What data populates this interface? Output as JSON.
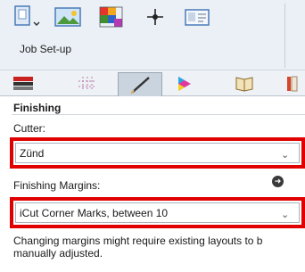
{
  "toolbar": {
    "buttons": [
      {
        "icon": "page-layout-icon",
        "has_dropdown": true
      },
      {
        "icon": "image-icon"
      },
      {
        "icon": "color-palette-icon"
      },
      {
        "icon": "crosshair-icon"
      },
      {
        "icon": "id-card-icon"
      }
    ],
    "section_label": "Job Set-up"
  },
  "tabs": [
    {
      "icon": "media-stack-icon",
      "active": false
    },
    {
      "icon": "grid-dots-icon",
      "active": false
    },
    {
      "icon": "cut-line-icon",
      "active": true
    },
    {
      "icon": "color-profile-icon",
      "active": false
    },
    {
      "icon": "book-icon",
      "active": false
    },
    {
      "icon": "partial-icon",
      "active": false
    }
  ],
  "finishing": {
    "heading": "Finishing",
    "cutter_label": "Cutter:",
    "cutter_value": "Zünd",
    "margins_label": "Finishing Margins:",
    "margins_value": "iCut Corner Marks, between 10",
    "note_line1": "Changing margins might require existing layouts to b",
    "note_line2": "manually adjusted."
  },
  "colors": {
    "highlight_border": "#e00000",
    "toolbar_bg": "#eaf0f6",
    "active_tab_bg": "#c9d4df"
  }
}
